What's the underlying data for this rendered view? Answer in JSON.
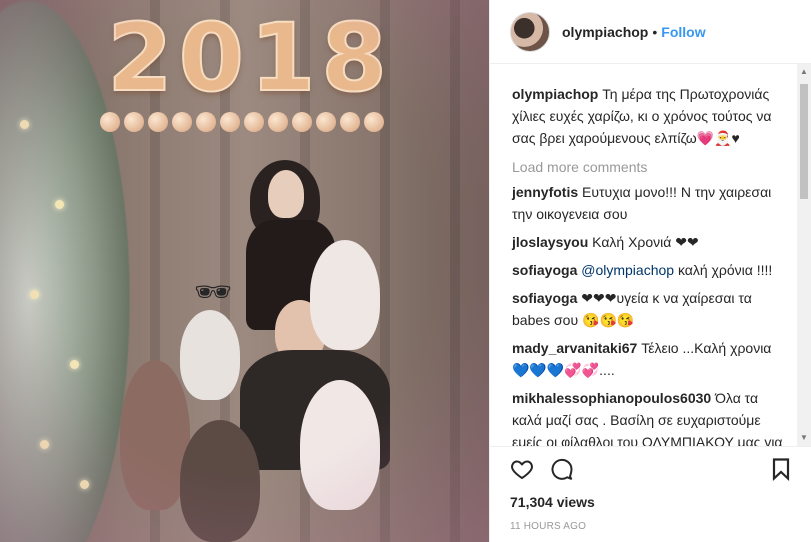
{
  "header": {
    "username": "olympiachop",
    "separator": "•",
    "follow_label": "Follow"
  },
  "media": {
    "balloon_text": "2018"
  },
  "caption": {
    "username": "olympiachop",
    "text": "Τη μέρα της Πρωτοχρονιάς χίλιες ευχές χαρίζω, κι ο χρόνος τούτος να σας βρει χαρούμενους ελπίζω💗🎅♥"
  },
  "load_more_label": "Load more comments",
  "comments": [
    {
      "username": "jennyfotis",
      "text": "Ευτυχια μονο!!! Ν την χαιρεσαι την οικογενεια σου"
    },
    {
      "username": "jloslaysyou",
      "text": "Καλή Χρονιά ❤❤"
    },
    {
      "username": "sofiayoga",
      "mention": "@olympiachop",
      "text": "καλή χρόνια !!!!"
    },
    {
      "username": "sofiayoga",
      "text": "❤❤❤υγεία κ να χαίρεσαι τα babes σου 😘😘😘"
    },
    {
      "username": "mady_arvanitaki67",
      "text": "Τέλειο ...Καλή χρονια 💙💙💙💞💞...."
    },
    {
      "username": "mikhalessophianopoulos6030",
      "text": "Όλα τα καλά μαζί σας . Βασίλη σε ευχαριστούμε εμείς οι φίλαθλοι του ΟΛΥΜΠΙΑΚΟΥ μας για όσα μας έχεις προσφέρει και συνεχίζεις να μας κάνεις ευτυχισμένους"
    }
  ],
  "stats": {
    "views": "71,304 views",
    "time_ago": "11 HOURS AGO"
  },
  "icons": {
    "like": "heart-icon",
    "comment": "comment-icon",
    "save": "bookmark-icon"
  },
  "colors": {
    "follow": "#3897f0",
    "muted": "#999999",
    "text": "#262626"
  }
}
